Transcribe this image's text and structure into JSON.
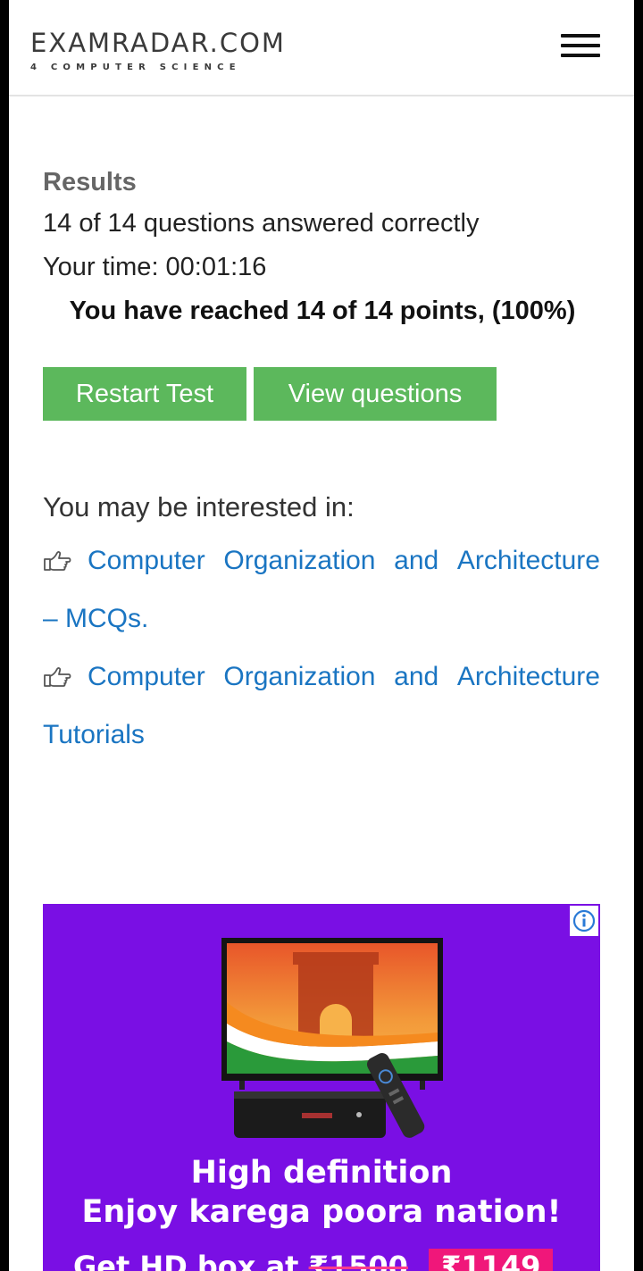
{
  "header": {
    "logo_main": "EXAMRADAR.COM",
    "logo_sub": "4 COMPUTER SCIENCE",
    "menu_icon": "hamburger-menu-icon"
  },
  "results": {
    "heading": "Results",
    "answered": "14 of 14 questions answered correctly",
    "time": "Your time: 00:01:16",
    "points": "You have reached 14 of 14 points, (100%)"
  },
  "buttons": {
    "restart": "Restart Test",
    "view": "View questions",
    "color": "#5cb85c"
  },
  "related": {
    "heading": "You may be interested in:",
    "icon": "hand-point-right-icon",
    "link_color": "#1a75c2",
    "items": [
      {
        "words": [
          "Computer",
          "Organization",
          "and",
          "Architecture"
        ],
        "tail": "– MCQs."
      },
      {
        "words": [
          "Computer",
          "Organization",
          "and",
          "Architecture"
        ],
        "tail": "Tutorials"
      }
    ]
  },
  "ad": {
    "background": "#7a0fe4",
    "info_icon": "info-icon",
    "line1": "High definition",
    "line2": "Enjoy karega poora nation!",
    "line3_prefix": "Get HD box at",
    "old_price": "₹1500",
    "new_price": "₹1149"
  }
}
